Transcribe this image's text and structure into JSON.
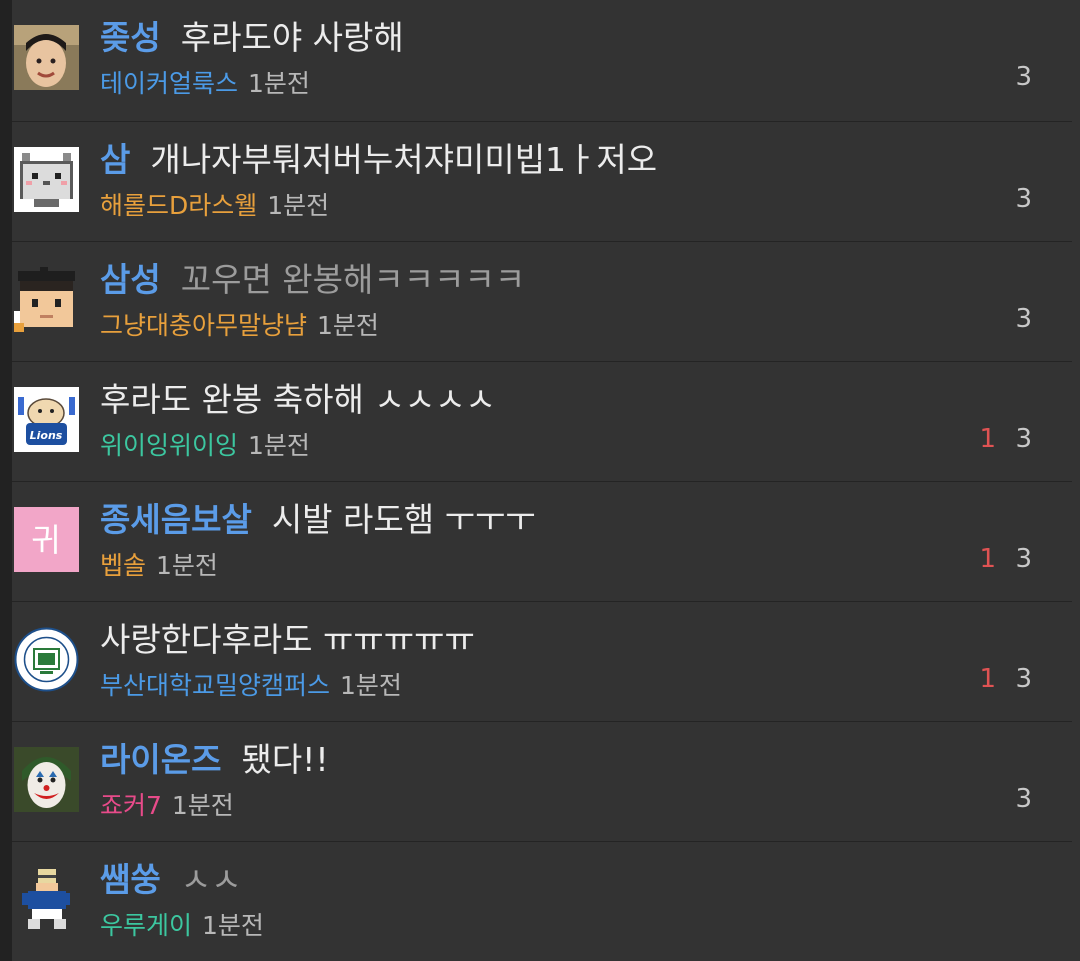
{
  "posts": [
    {
      "category": "좆성",
      "title": "후라도야 사랑해",
      "author": "테이커얼룩스",
      "author_color": "#4b9ae6",
      "time": "1분전",
      "reply_count": "",
      "views": "3",
      "avatar": "boy-photo-avatar",
      "title_dim": false
    },
    {
      "category": "삼",
      "title": "개나자부퉈저버누처쟈미미빕1ㅏ저오",
      "author": "해롤드D라스웰",
      "author_color": "#e8a03c",
      "time": "1분전",
      "reply_count": "",
      "views": "3",
      "avatar": "pixel-cat-avatar",
      "title_dim": false
    },
    {
      "category": "삼성",
      "title": "꼬우면 완봉해ㅋㅋㅋㅋㅋ",
      "author": "그냥대충아무말냥냠",
      "author_color": "#e8a03c",
      "time": "1분전",
      "reply_count": "",
      "views": "3",
      "avatar": "pixel-graduate-avatar",
      "title_dim": true
    },
    {
      "category": "",
      "title": "후라도 완봉 축하해 ㅅㅅㅅㅅ",
      "author": "위이잉위이잉",
      "author_color": "#3cc7a0",
      "time": "1분전",
      "reply_count": "1",
      "views": "3",
      "avatar": "lions-mascot-avatar",
      "title_dim": false
    },
    {
      "category": "종세음보살",
      "title": "시발 라도햄 ㅜㅜㅜ",
      "author": "벱솔",
      "author_color": "#e8a03c",
      "time": "1분전",
      "reply_count": "1",
      "views": "3",
      "avatar": "pink-letter-avatar",
      "avatar_text": "귀",
      "title_dim": false
    },
    {
      "category": "",
      "title": "사랑한다후라도 ㅠㅠㅠㅠㅠ",
      "author": "부산대학교밀양캠퍼스",
      "author_color": "#4b9ae6",
      "time": "1분전",
      "reply_count": "1",
      "views": "3",
      "avatar": "university-emblem-avatar",
      "title_dim": false
    },
    {
      "category": "라이온즈",
      "title": "됐다!!",
      "author": "죠커7",
      "author_color": "#e84b8a",
      "time": "1분전",
      "reply_count": "",
      "views": "3",
      "avatar": "joker-avatar",
      "title_dim": false
    },
    {
      "category": "쌤쑹",
      "title": "ㅅㅅ",
      "author": "우루게이",
      "author_color": "#3cc7a0",
      "time": "1분전",
      "reply_count": "",
      "views": "",
      "avatar": "pixel-football-player-avatar",
      "title_dim": true
    }
  ]
}
